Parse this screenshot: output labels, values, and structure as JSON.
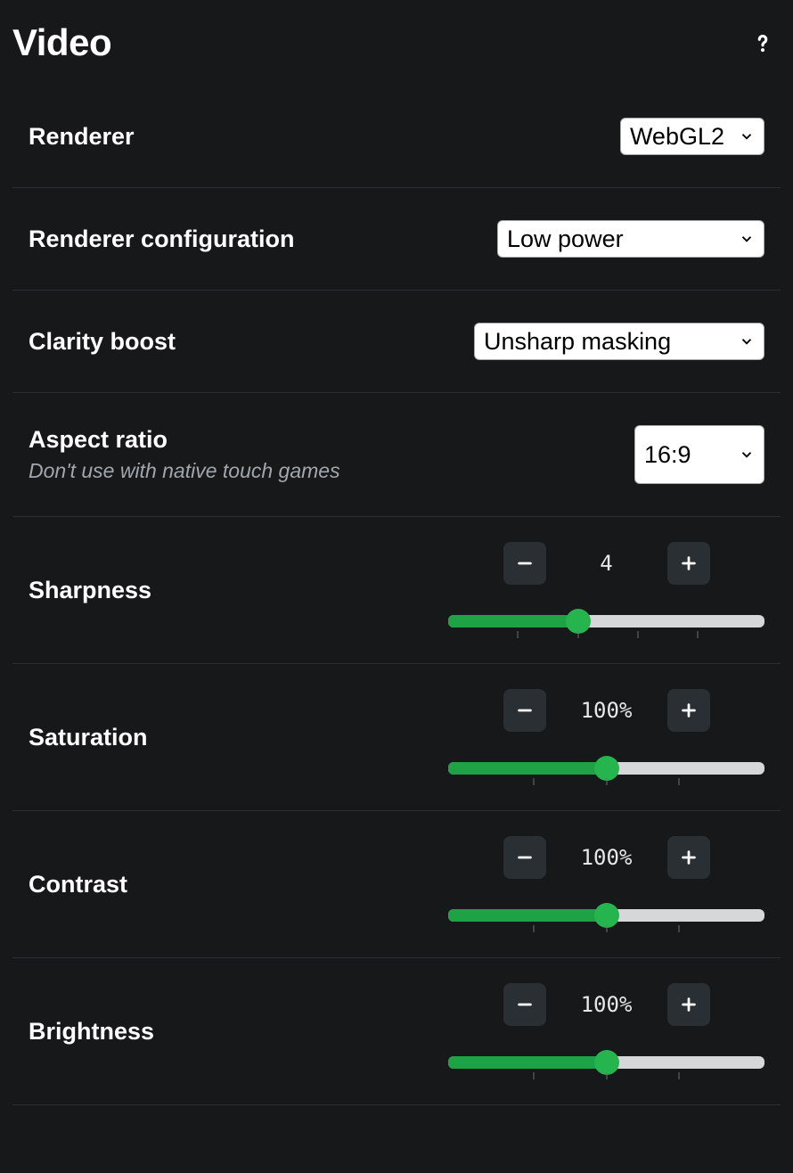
{
  "header": {
    "title": "Video"
  },
  "settings": {
    "renderer": {
      "label": "Renderer",
      "value": "WebGL2"
    },
    "renderer_config": {
      "label": "Renderer configuration",
      "value": "Low power"
    },
    "clarity_boost": {
      "label": "Clarity boost",
      "value": "Unsharp masking"
    },
    "aspect_ratio": {
      "label": "Aspect ratio",
      "sublabel": "Don't use with native touch games",
      "value": "16:9"
    },
    "sharpness": {
      "label": "Sharpness",
      "value_display": "4",
      "fill_percent": 41,
      "ticks": [
        22,
        41,
        60,
        79
      ]
    },
    "saturation": {
      "label": "Saturation",
      "value_display": "100%",
      "fill_percent": 50,
      "ticks": [
        27,
        50,
        73
      ]
    },
    "contrast": {
      "label": "Contrast",
      "value_display": "100%",
      "fill_percent": 50,
      "ticks": [
        27,
        50,
        73
      ]
    },
    "brightness": {
      "label": "Brightness",
      "value_display": "100%",
      "fill_percent": 50,
      "ticks": [
        27,
        50,
        73
      ]
    }
  }
}
